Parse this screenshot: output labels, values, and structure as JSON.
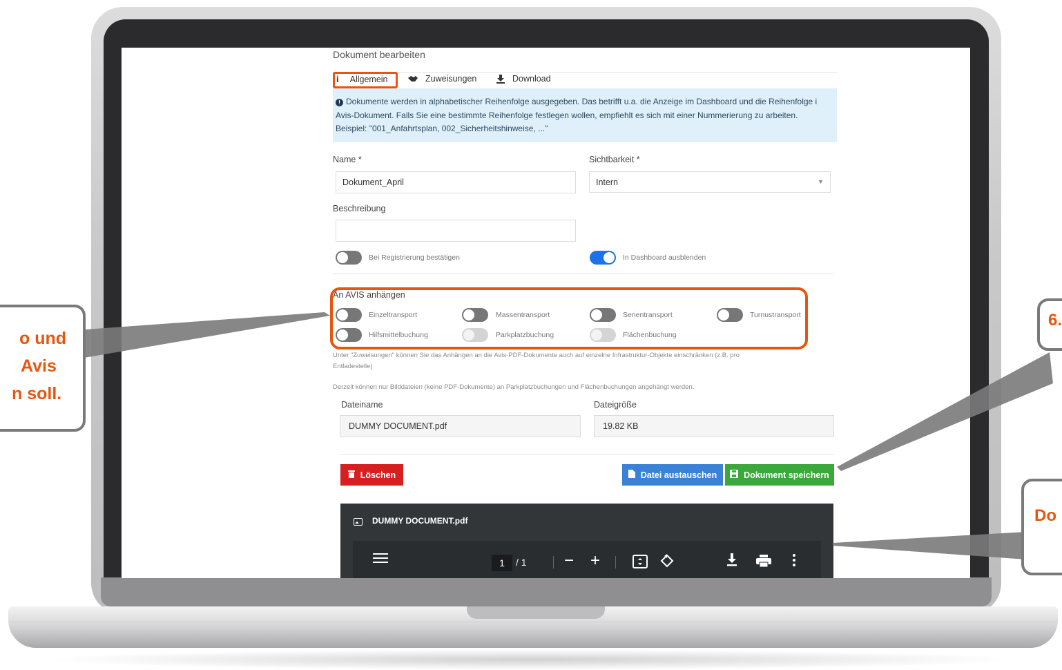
{
  "app": {
    "page_title": "Dokument bearbeiten"
  },
  "tabs": [
    {
      "label": "Allgemein",
      "icon": "info-icon",
      "active": true
    },
    {
      "label": "Zuweisungen",
      "icon": "handshake-icon",
      "active": false
    },
    {
      "label": "Download",
      "icon": "download-icon",
      "active": false
    }
  ],
  "info_notice": {
    "line1": "Dokumente werden in alphabetischer Reihenfolge ausgegeben. Das betrifft u.a. die Anzeige im Dashboard und die Reihenfolge i",
    "line2": "Avis-Dokument. Falls Sie eine bestimmte Reihenfolge festlegen wollen, empfiehlt es sich mit einer Nummerierung zu arbeiten.",
    "line3": "Beispiel: \"001_Anfahrtsplan, 002_Sicherheitshinweise, ...\""
  },
  "form": {
    "name_label": "Name *",
    "name_value": "Dokument_April",
    "visibility_label": "Sichtbarkeit *",
    "visibility_value": "Intern",
    "description_label": "Beschreibung",
    "description_value": "",
    "toggle_registration_label": "Bei Registrierung bestätigen",
    "toggle_registration_on": false,
    "toggle_dashboard_label": "In Dashboard ausblenden",
    "toggle_dashboard_on": true
  },
  "avis": {
    "heading": "An AVIS anhängen",
    "options": [
      {
        "label": "Einzeltransport",
        "on": false,
        "disabled": false
      },
      {
        "label": "Massentransport",
        "on": false,
        "disabled": false
      },
      {
        "label": "Serientransport",
        "on": false,
        "disabled": false
      },
      {
        "label": "Turnustransport",
        "on": false,
        "disabled": false
      },
      {
        "label": "Hilfsmittelbuchung",
        "on": false,
        "disabled": false
      },
      {
        "label": "Parkplatzbuchung",
        "on": false,
        "disabled": true
      },
      {
        "label": "Flächenbuchung",
        "on": false,
        "disabled": true
      }
    ],
    "hint1_line1": "Unter \"Zuweisungen\" können Sie das Anhängen an die Avis-PDF-Dokumente auch auf einzelne Infrastruktur-Objekte einschränken (z.B. pro",
    "hint1_line2": "Entladestelle)",
    "hint2": "Derzeit können nur Bilddateien (keine PDF-Dokumente) an Parkplatzbuchungen und Flächenbuchungen angehängt werden."
  },
  "file": {
    "filename_label": "Dateiname",
    "filename_value": "DUMMY DOCUMENT.pdf",
    "filesize_label": "Dateigröße",
    "filesize_value": "19.82 KB"
  },
  "buttons": {
    "delete": "Löschen",
    "replace": "Datei austauschen",
    "save": "Dokument speichern"
  },
  "viewer": {
    "filename": "DUMMY DOCUMENT.pdf",
    "page_current": "1",
    "page_total": "/ 1"
  },
  "callouts": {
    "left_line1": "o und",
    "left_line2": "Avis",
    "left_line3": "n soll.",
    "right_top": "6.",
    "right_bottom": "Do"
  },
  "colors": {
    "accent_orange": "#e8560e",
    "primary_blue": "#1a73e8",
    "danger_red": "#d62020",
    "save_green": "#3aa83a",
    "replace_blue": "#3b82d6",
    "info_bg": "#dff0fa"
  }
}
